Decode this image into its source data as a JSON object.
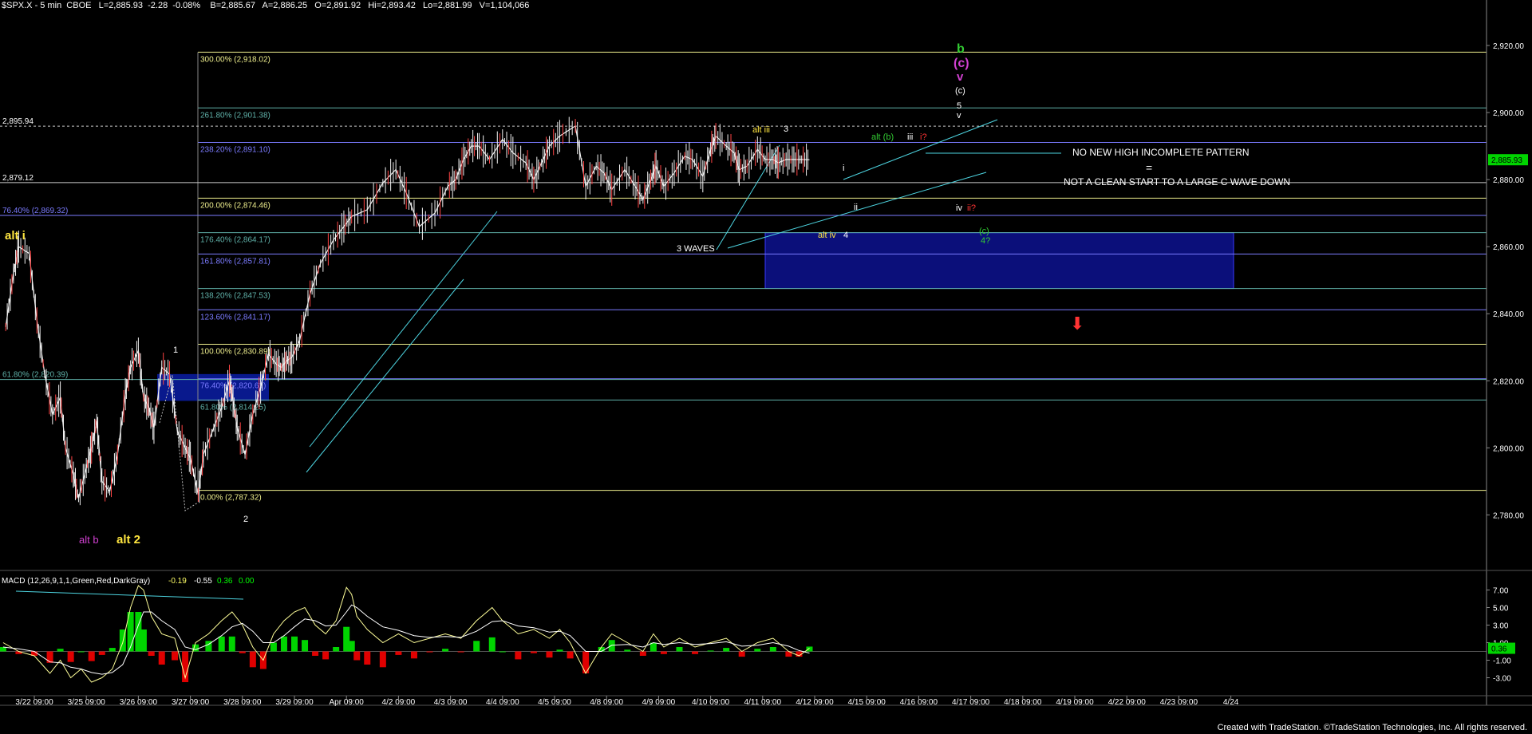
{
  "header": {
    "text": "$SPX.X - 5 min  CBOE   L=2,885.93  -2.28  -0.08%    B=2,885.67   A=2,886.25   O=2,891.92   Hi=2,893.42   Lo=2,881.99   V=1,104,066"
  },
  "footer": {
    "text": "Created with TradeStation. ©TradeStation Technologies, Inc. All rights reserved."
  },
  "colors": {
    "background": "#000000",
    "price_bars": "#f2f2f2",
    "fib_yellow": "#ecec8c",
    "fib_teal": "#5fb0a8",
    "fib_blue": "#7b7bff",
    "channel": "#4dd4e0",
    "target_box": "#0b0f7a",
    "macd_pos": "#00d400",
    "macd_neg": "#e00000",
    "green": "#33cc33",
    "magenta": "#d040d0",
    "red": "#ff3333",
    "yellow": "#ffe640"
  },
  "chart_data": {
    "type": "line",
    "symbol": "$SPX.X - 5 min",
    "price_axis": {
      "ylim": [
        2767,
        2930
      ],
      "ticks": [
        "2,920.00",
        "2,900.00",
        "2,880.00",
        "2,860.00",
        "2,840.00",
        "2,820.00",
        "2,800.00",
        "2,780.00"
      ],
      "tick_values": [
        2920,
        2900,
        2880,
        2860,
        2840,
        2820,
        2800,
        2780
      ],
      "last_price_label": "2,885.93",
      "last_price": 2885.93
    },
    "macd_axis": {
      "ylim": [
        -4.5,
        8.5
      ],
      "ticks": [
        "7.00",
        "5.00",
        "3.00",
        "1.00",
        "-1.00",
        "-3.00"
      ],
      "tick_values": [
        7,
        5,
        3,
        1,
        -1,
        -3
      ],
      "last_value_label": "0.36",
      "last_value": 0.36
    },
    "x_axis": {
      "tick_labels": [
        "3/22  09:00",
        "3/25  09:00",
        "3/26  09:00",
        "3/27  09:00",
        "3/28  09:00",
        "3/29  09:00",
        "Apr  09:00",
        "4/2  09:00",
        "4/3  09:00",
        "4/4  09:00",
        "4/5  09:00",
        "4/8  09:00",
        "4/9  09:00",
        "4/10  09:00",
        "4/11  09:00",
        "4/12  09:00",
        "4/15  09:00",
        "4/16  09:00",
        "4/17  09:00",
        "4/18  09:00",
        "4/19  09:00",
        "4/22  09:00",
        "4/23  09:00",
        "4/24"
      ],
      "tick_index": [
        0,
        1,
        2,
        3,
        4,
        5,
        6,
        7,
        8,
        9,
        10,
        11,
        12,
        13,
        14,
        15,
        16,
        17,
        18,
        19,
        20,
        21,
        22,
        23
      ]
    },
    "price_series": {
      "name": "$SPX.X",
      "x": [
        -0.55,
        -0.4,
        -0.3,
        -0.1,
        0.05,
        0.2,
        0.35,
        0.5,
        0.6,
        0.75,
        0.85,
        1.0,
        1.1,
        1.2,
        1.3,
        1.45,
        1.6,
        1.75,
        1.85,
        2.0,
        2.1,
        2.2,
        2.3,
        2.45,
        2.6,
        2.75,
        2.9,
        3.0,
        3.15,
        3.25,
        3.45,
        3.6,
        3.75,
        3.8,
        3.9,
        4.05,
        4.2,
        4.35,
        4.5,
        4.65,
        4.75,
        4.85,
        4.95,
        5.1,
        5.3,
        5.5,
        5.75,
        5.95,
        6.1,
        6.4,
        6.7,
        6.95,
        7.15,
        7.4,
        7.7,
        7.95,
        8.1,
        8.25,
        8.4,
        8.55,
        8.75,
        9.0,
        9.2,
        9.45,
        9.6,
        9.75,
        9.9,
        10.1,
        10.4,
        10.6,
        10.8,
        10.95,
        11.1,
        11.35,
        11.55,
        11.7,
        11.85,
        11.95,
        12.1,
        12.3,
        12.5,
        12.65,
        12.85,
        13.0,
        13.1,
        13.3,
        13.45,
        13.55,
        13.7,
        13.9,
        14.05,
        14.2,
        14.3,
        14.45,
        14.6,
        14.75,
        14.9
      ],
      "values": [
        2836,
        2852,
        2860,
        2858,
        2838,
        2822,
        2810,
        2815,
        2800,
        2792,
        2785,
        2794,
        2800,
        2808,
        2790,
        2787,
        2798,
        2816,
        2824,
        2829,
        2815,
        2812,
        2806,
        2824,
        2822,
        2805,
        2800,
        2797,
        2786,
        2798,
        2806,
        2812,
        2820,
        2816,
        2806,
        2798,
        2810,
        2818,
        2828,
        2825,
        2824,
        2826,
        2827,
        2832,
        2846,
        2855,
        2862,
        2866,
        2869,
        2871,
        2879,
        2883,
        2876,
        2866,
        2870,
        2878,
        2880,
        2886,
        2890,
        2890,
        2886,
        2892,
        2888,
        2885,
        2880,
        2885,
        2890,
        2893,
        2896,
        2878,
        2884,
        2882,
        2877,
        2883,
        2878,
        2874,
        2880,
        2884,
        2878,
        2882,
        2887,
        2886,
        2881,
        2889,
        2893,
        2890,
        2888,
        2883,
        2884,
        2889,
        2886,
        2886,
        2885,
        2886,
        2886,
        2886,
        2885.93
      ]
    },
    "fib_levels": [
      {
        "label": "300.00% (2,918.02)",
        "value": 2918.02,
        "color": "yellow"
      },
      {
        "label": "261.80% (2,901.38)",
        "value": 2901.38,
        "color": "teal"
      },
      {
        "label": "238.20% (2,891.10)",
        "value": 2891.1,
        "color": "blue"
      },
      {
        "label": "200.00% (2,874.46)",
        "value": 2874.46,
        "color": "yellow"
      },
      {
        "label": "176.40% (2,864.17)",
        "value": 2864.17,
        "color": "teal"
      },
      {
        "label": "161.80% (2,857.81)",
        "value": 2857.81,
        "color": "blue"
      },
      {
        "label": "138.20% (2,847.53)",
        "value": 2847.53,
        "color": "teal"
      },
      {
        "label": "123.60% (2,841.17)",
        "value": 2841.17,
        "color": "blue"
      },
      {
        "label": "100.00% (2,830.89)",
        "value": 2830.89,
        "color": "yellow"
      },
      {
        "label": "76.40% (2,820.61)",
        "value": 2820.61,
        "color": "blue"
      },
      {
        "label": "61.80% (2,814.25)",
        "value": 2814.25,
        "color": "teal"
      },
      {
        "label": "0.00% (2,787.32)",
        "value": 2787.32,
        "color": "yellow"
      }
    ],
    "left_levels": [
      {
        "label": "2,895.94",
        "value": 2895.94
      },
      {
        "label": "2,879.12",
        "value": 2879.12
      },
      {
        "label": "76.40% (2,869.32)",
        "value": 2869.32
      },
      {
        "label": "61.80% (2,820.39)",
        "value": 2820.39
      }
    ],
    "macd": {
      "title": "MACD (12,26,9,1,1,Green,Red,DarkGray)",
      "readouts": [
        "-0.19",
        "-0.55",
        "0.36",
        "0.00"
      ],
      "x": [
        -0.6,
        -0.3,
        0.0,
        0.3,
        0.5,
        0.7,
        0.9,
        1.1,
        1.3,
        1.5,
        1.7,
        1.85,
        2.0,
        2.1,
        2.25,
        2.45,
        2.7,
        2.9,
        3.1,
        3.35,
        3.6,
        3.8,
        4.0,
        4.2,
        4.4,
        4.6,
        4.8,
        5.0,
        5.2,
        5.4,
        5.6,
        5.8,
        6.0,
        6.1,
        6.2,
        6.4,
        6.7,
        7.0,
        7.3,
        7.6,
        7.9,
        8.2,
        8.5,
        8.8,
        9.0,
        9.3,
        9.6,
        9.9,
        10.1,
        10.3,
        10.6,
        10.9,
        11.1,
        11.4,
        11.7,
        11.9,
        12.1,
        12.4,
        12.7,
        13.0,
        13.3,
        13.6,
        13.9,
        14.2,
        14.5,
        14.7,
        14.9
      ],
      "macd_line": [
        1.0,
        0.0,
        -0.5,
        -2.5,
        -1.0,
        -3.0,
        -2.0,
        -3.5,
        -3.0,
        -2.0,
        1.0,
        5.0,
        7.5,
        7.0,
        4.0,
        2.0,
        1.5,
        -3.0,
        1.0,
        2.0,
        3.5,
        4.5,
        3.0,
        0.5,
        -1.0,
        2.0,
        3.5,
        4.5,
        5.0,
        3.0,
        2.0,
        3.5,
        7.3,
        6.5,
        4.0,
        2.5,
        1.0,
        2.0,
        1.0,
        1.5,
        2.0,
        1.5,
        3.5,
        5.0,
        3.5,
        2.0,
        2.5,
        1.5,
        2.5,
        1.0,
        -2.5,
        0.5,
        2.0,
        1.0,
        0.0,
        2.0,
        0.5,
        1.5,
        0.5,
        1.0,
        1.5,
        0.0,
        1.0,
        1.5,
        0.0,
        -0.5,
        0.36
      ],
      "signal_line": [
        0.5,
        0.3,
        0.0,
        -1.2,
        -1.3,
        -1.8,
        -2.0,
        -2.4,
        -2.6,
        -2.4,
        -1.5,
        0.5,
        3.0,
        4.5,
        4.5,
        3.5,
        2.5,
        0.5,
        0.2,
        0.8,
        1.8,
        2.8,
        3.2,
        2.3,
        1.0,
        1.0,
        1.8,
        2.8,
        3.7,
        3.5,
        2.9,
        3.0,
        4.5,
        5.3,
        5.0,
        4.0,
        2.8,
        2.4,
        1.8,
        1.6,
        1.7,
        1.6,
        2.3,
        3.4,
        3.5,
        2.9,
        2.7,
        2.2,
        2.3,
        1.8,
        0.0,
        0.0,
        0.7,
        0.8,
        0.5,
        1.0,
        0.8,
        1.0,
        0.8,
        0.9,
        1.1,
        0.6,
        0.7,
        1.0,
        0.6,
        0.1,
        -0.19
      ],
      "histogram": [
        0.5,
        -0.3,
        -0.5,
        -1.3,
        0.3,
        -1.2,
        0.0,
        -1.1,
        -0.4,
        0.4,
        2.5,
        4.5,
        4.5,
        2.5,
        -0.5,
        -1.5,
        -1.0,
        -3.5,
        0.8,
        1.2,
        1.7,
        1.7,
        -0.2,
        -1.8,
        -2.0,
        1.0,
        1.7,
        1.7,
        1.3,
        -0.5,
        -0.9,
        0.5,
        2.8,
        1.2,
        -1.0,
        -1.5,
        -1.8,
        -0.4,
        -0.8,
        -0.1,
        0.3,
        -0.1,
        1.2,
        1.6,
        0.0,
        -0.9,
        -0.2,
        -0.7,
        0.2,
        -0.8,
        -2.5,
        0.5,
        1.3,
        0.2,
        -0.5,
        1.0,
        -0.3,
        0.5,
        -0.3,
        0.1,
        0.4,
        -0.6,
        0.3,
        0.5,
        -0.6,
        -0.6,
        0.55
      ]
    }
  },
  "annotations": {
    "wave_b": "b",
    "wave_c_paren": "(c)",
    "wave_v_magenta": "v",
    "wave_c_small": "(c)",
    "wave_5": "5",
    "wave_v_small": "v",
    "alt_iii": "alt iii",
    "wave_3": "3",
    "alt_b_paren": "alt (b)",
    "wave_iii": "iii",
    "wave_i_q": "i?",
    "wave_i": "i",
    "wave_ii": "ii",
    "wave_iv": "iv",
    "wave_ii_q": "ii?",
    "alt_iv": "alt iv",
    "wave_4": "4",
    "wave_c_green": "(c)",
    "wave_4_q": "4?",
    "three_waves": "3 WAVES",
    "no_new_high": "NO NEW HIGH INCOMPLETE PATTERN",
    "equals": "=",
    "not_clean": "NOT A CLEAN START TO A LARGE C WAVE DOWN",
    "alt_i": "alt i",
    "wave_1": "1",
    "wave_2": "2",
    "alt_b": "alt b",
    "alt_2": "alt 2",
    "down_arrow": "⬇"
  }
}
